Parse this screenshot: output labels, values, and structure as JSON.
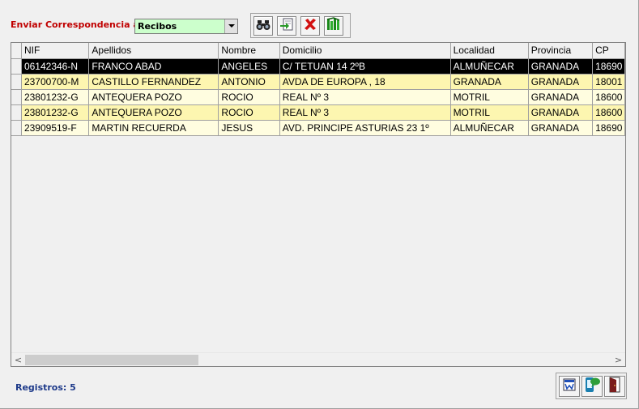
{
  "header": {
    "send_label": "Enviar Correspondencia a:",
    "combo_value": "Recibos"
  },
  "toolbar": {
    "icons": [
      "binoculars-icon",
      "import-icon",
      "delete-icon",
      "bookshelf-icon"
    ]
  },
  "grid": {
    "columns": [
      "NIF",
      "Apellidos",
      "Nombre",
      "Domicilio",
      "Localidad",
      "Provincia",
      "CP"
    ],
    "rows": [
      [
        "06142346-N",
        "FRANCO ABAD",
        "ANGELES",
        "C/ TETUAN 14 2ºB",
        "ALMUÑECAR",
        "GRANADA",
        "18690"
      ],
      [
        "23700700-M",
        "CASTILLO FERNANDEZ",
        "ANTONIO",
        "AVDA DE EUROPA , 18",
        "GRANADA",
        "GRANADA",
        "18001"
      ],
      [
        "23801232-G",
        "ANTEQUERA POZO",
        "ROCIO",
        "REAL Nº 3",
        "MOTRIL",
        "GRANADA",
        "18600"
      ],
      [
        "23801232-G",
        "ANTEQUERA POZO",
        "ROCIO",
        "REAL Nº 3",
        "MOTRIL",
        "GRANADA",
        "18600"
      ],
      [
        "23909519-F",
        "MARTIN RECUERDA",
        "JESUS",
        "AVD. PRINCIPE ASTURIAS 23 1º",
        "ALMUÑECAR",
        "GRANADA",
        "18690"
      ]
    ],
    "selected_row": 0
  },
  "footer": {
    "records_text": "Registros: 5",
    "icons": [
      "word-icon",
      "sms-icon",
      "exit-door-icon"
    ]
  },
  "colors": {
    "label_red": "#c00000",
    "combo_bg": "#ccffcc",
    "row_light": "#fffde0",
    "row_yellow": "#fdf6b0",
    "footer_blue": "#1e3a8a"
  }
}
